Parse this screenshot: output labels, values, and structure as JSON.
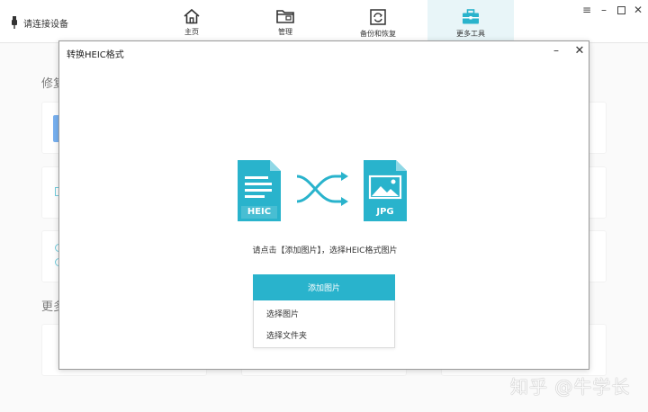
{
  "titlebar": {
    "device_label": "请连接设备",
    "tabs": [
      {
        "label": "主页",
        "icon": "home-icon"
      },
      {
        "label": "管理",
        "icon": "folder-icon"
      },
      {
        "label": "备份和恢复",
        "icon": "backup-restore-icon"
      },
      {
        "label": "更多工具",
        "icon": "toolbox-icon",
        "active": true
      }
    ],
    "window_controls": [
      "menu-icon",
      "minimize-icon",
      "maximize-icon",
      "close-icon"
    ]
  },
  "background": {
    "heading_fragment": "修复",
    "heading2_fragment": "更多"
  },
  "dialog": {
    "title": "转换HEIC格式",
    "source_format_label": "HEIC",
    "target_format_label": "JPG",
    "instruction": "请点击【添加图片】，选择HEIC格式图片",
    "add_button_label": "添加图片",
    "dropdown_items": [
      "选择图片",
      "选择文件夹"
    ]
  },
  "colors": {
    "accent": "#29b3cc",
    "active_tab_bg": "#e8f5f8"
  },
  "watermark": "知乎 @牛学长"
}
